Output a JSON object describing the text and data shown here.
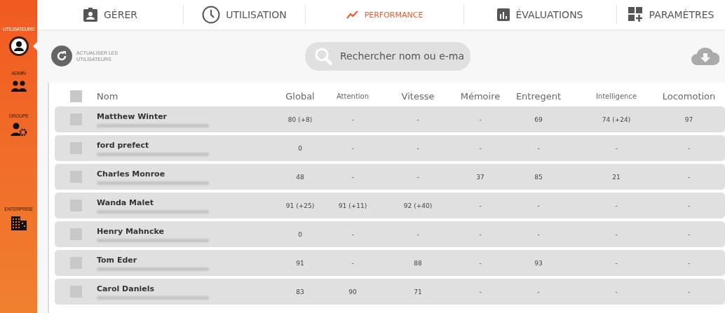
{
  "sidebar": {
    "items": [
      {
        "label": "UTILISATEURS",
        "selected": true
      },
      {
        "label": "ADMIN",
        "selected": false
      },
      {
        "label": "GROUPE",
        "selected": false
      },
      {
        "label": "ENTERPRISE",
        "selected": false
      }
    ]
  },
  "tabs": [
    {
      "label": "GÉRER",
      "selected": false
    },
    {
      "label": "UTILISATION",
      "selected": false
    },
    {
      "label": "PERFORMANCE",
      "selected": true
    },
    {
      "label": "ÉVALUATIONS",
      "selected": false
    },
    {
      "label": "PARAMÈTRES",
      "selected": false
    }
  ],
  "toolbar": {
    "refresh_label": "ACTUALISER LES UTILISATEURS",
    "search": {
      "placeholder": "Rechercher nom ou e-ma"
    }
  },
  "table": {
    "header_checked": false,
    "columns": [
      "Nom",
      "Global",
      "Attention",
      "Vitesse",
      "Mémoire",
      "Entregent",
      "Intelligence",
      "Locomotion"
    ],
    "rows": [
      {
        "checked": false,
        "cells": [
          "Matthew Winter",
          "80 (+8)",
          "-",
          "-",
          "-",
          "69",
          "74 (+24)",
          "97"
        ]
      },
      {
        "checked": false,
        "cells": [
          "ford prefect",
          "0",
          "-",
          "-",
          "-",
          "-",
          "-",
          "-"
        ]
      },
      {
        "checked": false,
        "cells": [
          "Charles Monroe",
          "48",
          "-",
          "-",
          "37",
          "85",
          "21",
          "-"
        ]
      },
      {
        "checked": false,
        "cells": [
          "Wanda Malet",
          "91 (+25)",
          "91 (+11)",
          "92 (+40)",
          "-",
          "-",
          "-",
          "-"
        ]
      },
      {
        "checked": false,
        "cells": [
          "Henry Mahncke",
          "0",
          "-",
          "-",
          "-",
          "-",
          "-",
          "-"
        ]
      },
      {
        "checked": false,
        "cells": [
          "Tom Eder",
          "91",
          "-",
          "88",
          "-",
          "93",
          "-",
          "-"
        ]
      },
      {
        "checked": false,
        "cells": [
          "Carol Daniels",
          "83",
          "90",
          "71",
          "-",
          "-",
          "-",
          "-"
        ]
      }
    ]
  }
}
